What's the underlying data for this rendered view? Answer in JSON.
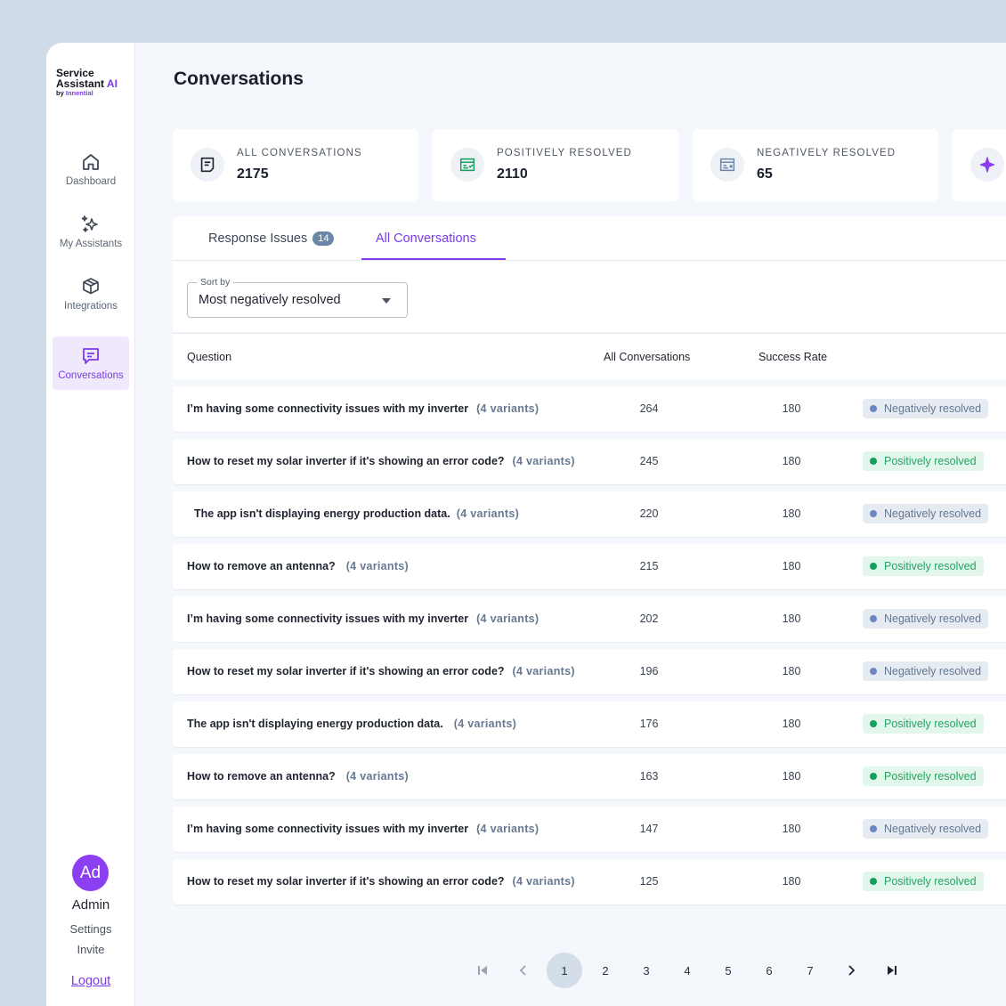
{
  "brand": {
    "line1": "Service",
    "line2": "Assistant",
    "line2_ai": "AI",
    "by": "by",
    "by_name": "Innential"
  },
  "nav": [
    {
      "label": "Dashboard",
      "icon": "home-icon"
    },
    {
      "label": "My Assistants",
      "icon": "sparkles-icon"
    },
    {
      "label": "Integrations",
      "icon": "package-icon"
    },
    {
      "label": "Conversations",
      "icon": "chat-icon"
    }
  ],
  "user": {
    "initials": "Ad",
    "name": "Admin",
    "settings": "Settings",
    "invite": "Invite",
    "logout": "Logout"
  },
  "page": {
    "title": "Conversations"
  },
  "stats": [
    {
      "label": "ALL CONVERSATIONS",
      "value": "2175"
    },
    {
      "label": "POSITIVELY RESOLVED",
      "value": "2110"
    },
    {
      "label": "NEGATIVELY RESOLVED",
      "value": "65"
    }
  ],
  "tabs": [
    {
      "label": "Response Issues",
      "badge": "14"
    },
    {
      "label": "All Conversations"
    }
  ],
  "sort": {
    "legend": "Sort by",
    "value": "Most negatively resolved"
  },
  "table": {
    "headers": [
      "Question",
      "All Conversations",
      "Success Rate"
    ],
    "rows": [
      {
        "question": "I’m having some connectivity issues with my inverter",
        "variants": "(4 variants)",
        "count": "264",
        "rate": "180",
        "status": "Negatively resolved"
      },
      {
        "question": "How to reset my solar inverter if it's showing an error code?",
        "variants": "(4 variants)",
        "count": "245",
        "rate": "180",
        "status": "Positively resolved"
      },
      {
        "question": "The app isn't displaying  energy production data.",
        "variants": "(4 variants)",
        "count": "220",
        "rate": "180",
        "status": "Negatively resolved"
      },
      {
        "question": "How to remove an antenna?",
        "variants": "(4 variants)",
        "count": "215",
        "rate": "180",
        "status": "Positively resolved"
      },
      {
        "question": "I’m having some connectivity issues with my inverter",
        "variants": "(4 variants)",
        "count": "202",
        "rate": "180",
        "status": "Negatively resolved"
      },
      {
        "question": "How to reset my solar inverter if it's showing an error code?",
        "variants": "(4 variants)",
        "count": "196",
        "rate": "180",
        "status": "Negatively resolved"
      },
      {
        "question": "The app isn't displaying  energy production data.",
        "variants": "(4 variants)",
        "count": "176",
        "rate": "180",
        "status": "Positively resolved"
      },
      {
        "question": "How to remove an antenna?",
        "variants": "(4 variants)",
        "count": "163",
        "rate": "180",
        "status": "Positively resolved"
      },
      {
        "question": "I’m having some connectivity issues with my inverter",
        "variants": "(4 variants)",
        "count": "147",
        "rate": "180",
        "status": "Negatively resolved"
      },
      {
        "question": "How to reset my solar inverter if it's showing an error code?",
        "variants": "(4 variants)",
        "count": "125",
        "rate": "180",
        "status": "Positively resolved"
      }
    ]
  },
  "pagination": {
    "pages": [
      "1",
      "2",
      "3",
      "4",
      "5",
      "6",
      "7"
    ],
    "current": "1"
  },
  "colors": {
    "accent": "#7c3aed",
    "positive": "#13a05a",
    "negative": "#6b86c0",
    "background": "#cfdce8"
  }
}
